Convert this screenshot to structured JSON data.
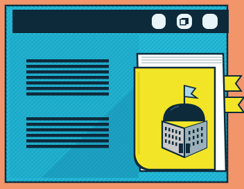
{
  "illustration": {
    "background_color": "#f2956a",
    "window": {
      "fill_color": "#22b8d6",
      "border_color": "#0d2a3a",
      "titlebar_color": "#0d2a3a",
      "titlebar_buttons": [
        {
          "icon": "circle-button-icon"
        },
        {
          "icon": "restore-window-icon"
        },
        {
          "icon": "circle-button-icon"
        }
      ],
      "text_line_groups": [
        {
          "line_count": 7
        },
        {
          "line_count": 6
        }
      ]
    },
    "book": {
      "cover_color": "#f2e528",
      "page_color": "#ffffff",
      "bookmark_color": "#f2e528",
      "icon": "domed-building-icon",
      "building": {
        "dome_color": "#0d2a3a",
        "wall_color": "#c9c9c9",
        "flag_color": "#a9d7e6"
      }
    }
  }
}
